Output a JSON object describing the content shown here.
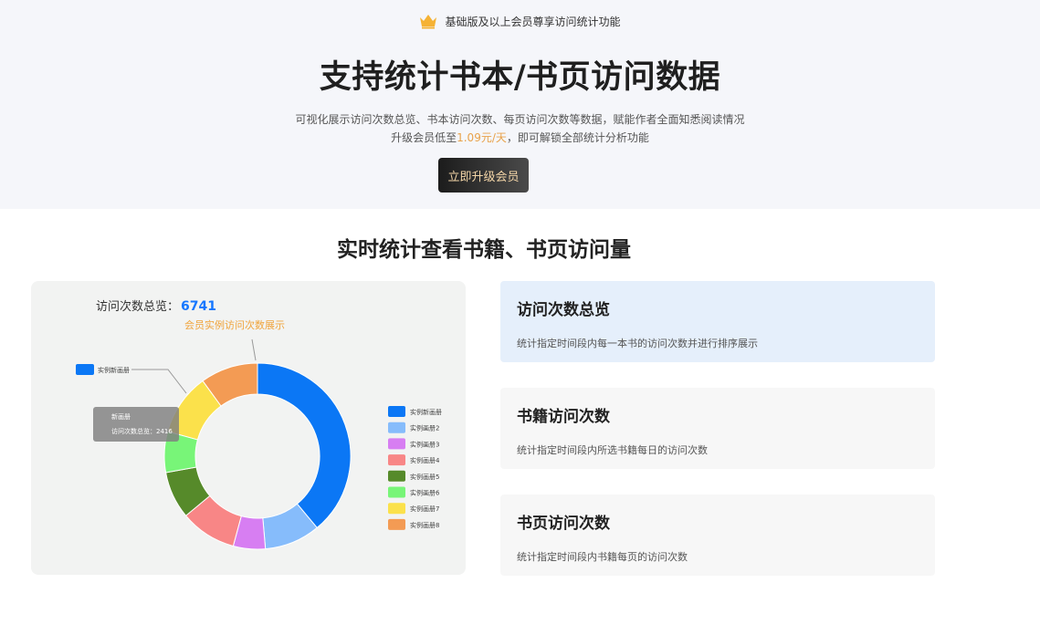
{
  "hero": {
    "badge_text": "基础版及以上会员尊享访问统计功能",
    "title": "支持统计书本/书页访问数据",
    "desc_line1": "可视化展示访问次数总览、书本访问次数、每页访问次数等数据，赋能作者全面知悉阅读情况",
    "desc_line2_prefix": "升级会员低至",
    "desc_line2_price": "1.09元/天",
    "desc_line2_suffix": "，即可解锁全部统计分析功能",
    "upgrade_button": "立即升级会员",
    "crown_color": "#f5b234"
  },
  "section_title": "实时统计查看书籍、书页访问量",
  "chart_card": {
    "total_label": "访问次数总览：",
    "total_value": "6741",
    "subtitle": "会员实例访问次数展示",
    "callout_label": "实例新画册",
    "tooltip": {
      "title": "新画册",
      "line": "访问次数总览：2416"
    }
  },
  "chart_data": {
    "type": "pie",
    "variant": "donut",
    "title": "会员实例访问次数展示",
    "legend_position": "right",
    "series": [
      {
        "name": "实例新画册",
        "value": 2416,
        "color": "#0b77f5"
      },
      {
        "name": "实例画册2",
        "value": 600,
        "color": "#86bcfb"
      },
      {
        "name": "实例画册3",
        "value": 345,
        "color": "#d77ef2"
      },
      {
        "name": "实例画册4",
        "value": 605,
        "color": "#f88686"
      },
      {
        "name": "实例画册5",
        "value": 510,
        "color": "#568a2a"
      },
      {
        "name": "实例画册6",
        "value": 440,
        "color": "#78f578"
      },
      {
        "name": "实例画册7",
        "value": 665,
        "color": "#fbe14b"
      },
      {
        "name": "实例画册8",
        "value": 620,
        "color": "#f39b54"
      }
    ]
  },
  "features": [
    {
      "title": "访问次数总览",
      "desc": "统计指定时间段内每一本书的访问次数并进行排序展示"
    },
    {
      "title": "书籍访问次数",
      "desc": "统计指定时间段内所选书籍每日的访问次数"
    },
    {
      "title": "书页访问次数",
      "desc": "统计指定时间段内书籍每页的访问次数"
    }
  ]
}
